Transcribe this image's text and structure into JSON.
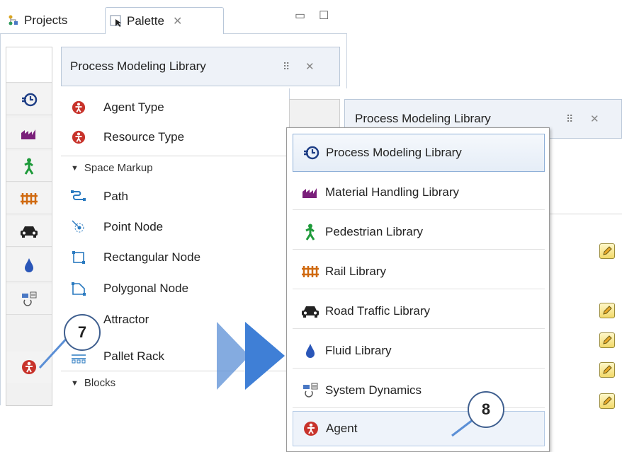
{
  "tabs": {
    "projects_label": "Projects",
    "palette_label": "Palette",
    "close_glyph": "✕",
    "minimize_glyph": "▭",
    "maximize_glyph": "☐"
  },
  "palette": {
    "library_title": "Process Modeling Library",
    "items_top": [
      {
        "label": "Agent Type",
        "icon": "agent-icon"
      },
      {
        "label": "Resource Type",
        "icon": "agent-icon"
      }
    ],
    "section_space": "Space Markup",
    "space_items": [
      {
        "label": "Path",
        "icon": "path-icon"
      },
      {
        "label": "Point Node",
        "icon": "point-node-icon"
      },
      {
        "label": "Rectangular Node",
        "icon": "rectangular-node-icon"
      },
      {
        "label": "Polygonal Node",
        "icon": "polygonal-node-icon"
      },
      {
        "label": "Attractor",
        "icon": "attractor-icon"
      },
      {
        "label": "Pallet Rack",
        "icon": "pallet-rack-icon"
      }
    ],
    "section_blocks": "Blocks"
  },
  "sidebar_icons": [
    "process-modeling-icon",
    "material-handling-icon",
    "pedestrian-icon",
    "rail-icon",
    "road-traffic-icon",
    "fluid-icon",
    "system-dynamics-icon",
    "agent-icon"
  ],
  "overlay": {
    "library_title": "Process Modeling Library",
    "menu": [
      {
        "label": "Process Modeling Library",
        "icon": "process-modeling-icon"
      },
      {
        "label": "Material Handling Library",
        "icon": "material-handling-icon"
      },
      {
        "label": "Pedestrian Library",
        "icon": "pedestrian-icon"
      },
      {
        "label": "Rail Library",
        "icon": "rail-icon"
      },
      {
        "label": "Road Traffic Library",
        "icon": "road-traffic-icon"
      },
      {
        "label": "Fluid Library",
        "icon": "fluid-icon"
      },
      {
        "label": "System Dynamics",
        "icon": "system-dynamics-icon"
      },
      {
        "label": "Agent",
        "icon": "agent-icon"
      }
    ]
  },
  "callouts": {
    "first": "7",
    "second": "8"
  },
  "colors": {
    "agent_red": "#c8332b",
    "material_purple": "#7a1f7a",
    "pedestrian_green": "#1e9a3a",
    "rail_orange": "#d06a10",
    "fluid_blue": "#2a56b8",
    "arrow_blue": "#5b8fd6"
  }
}
